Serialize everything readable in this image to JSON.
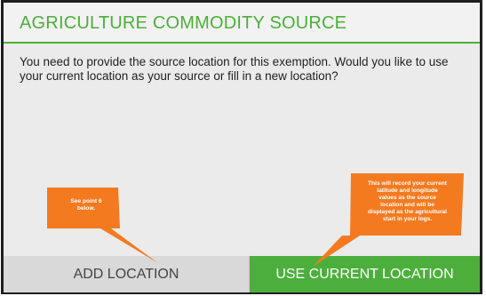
{
  "dialog": {
    "title": "AGRICULTURE COMMODITY SOURCE",
    "message": "You need to provide the source location for this exemption. Would you like to use your current location as your source or fill in a new location?"
  },
  "buttons": {
    "add_location": "ADD LOCATION",
    "use_current_location": "USE CURRENT LOCATION"
  },
  "annotations": {
    "add_note": "See point 6\nbelow.",
    "use_note": "This will record your current\nlatitude and longitude\nvalues as the source\nlocation and will be\ndisplayed as the agricultural\nstart in your logs."
  },
  "colors": {
    "accent_green": "#4caf3b",
    "annotation_orange": "#f47a20",
    "dialog_background": "#ebebeb"
  }
}
